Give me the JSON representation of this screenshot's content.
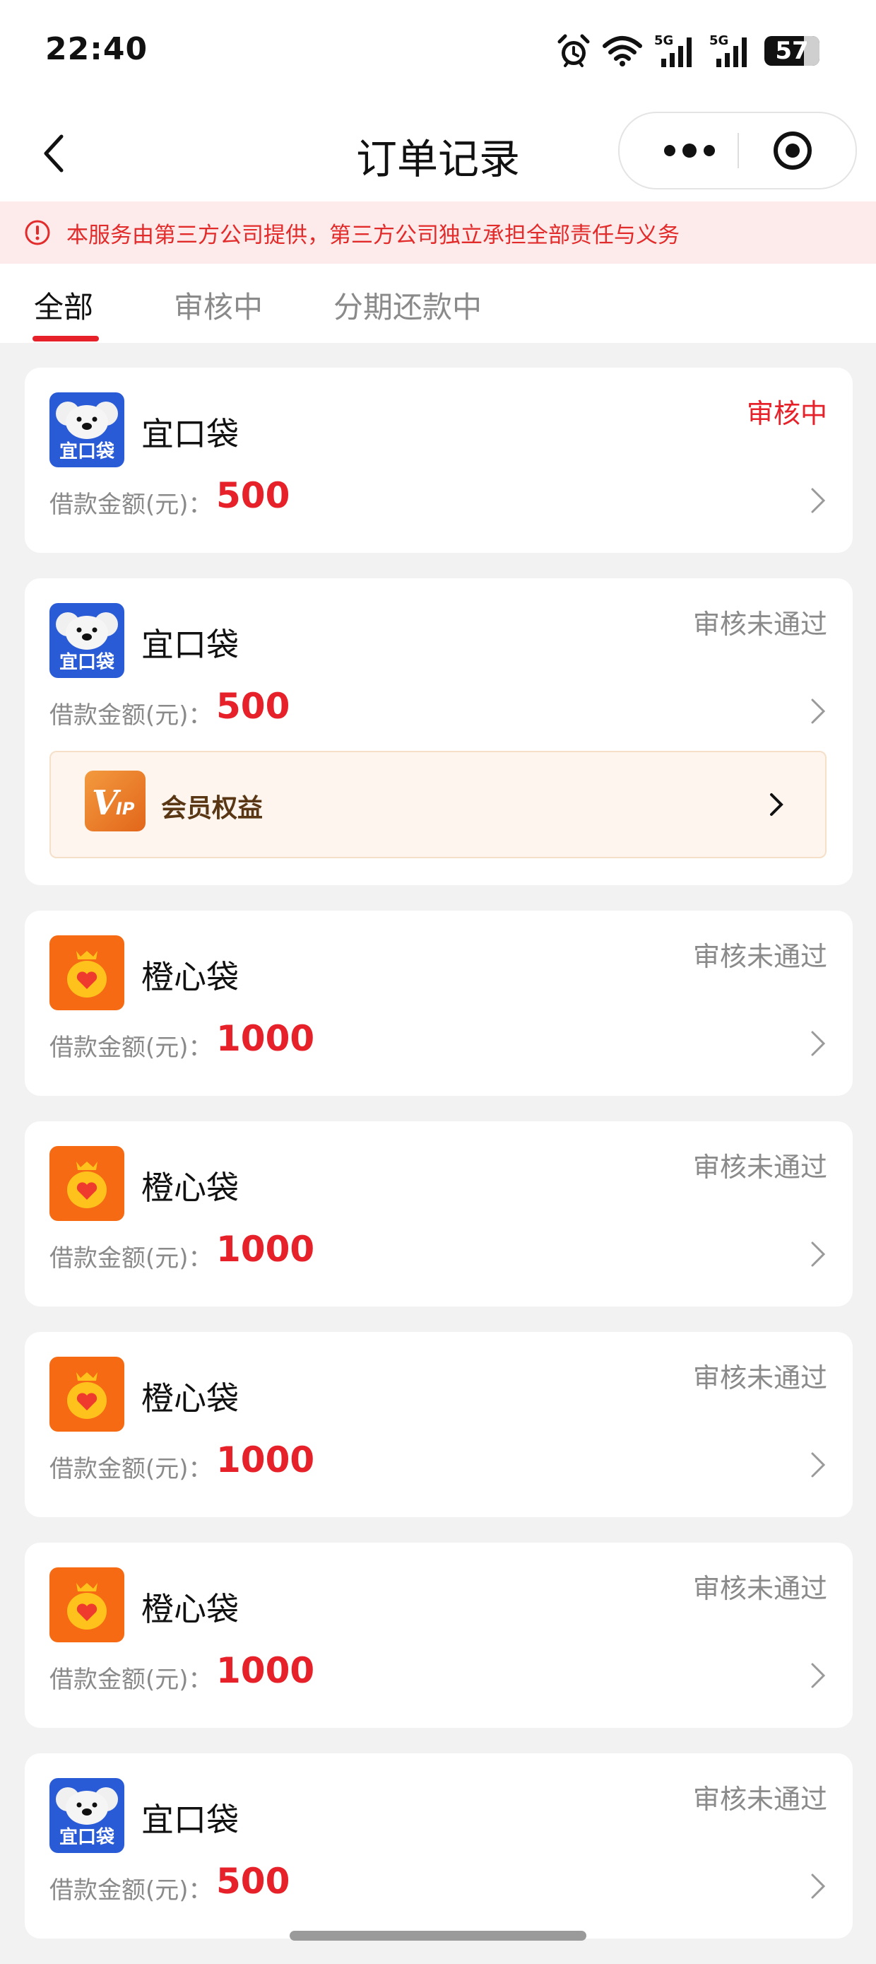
{
  "status_bar": {
    "time": "22:40",
    "network": "5G",
    "battery": "57"
  },
  "nav": {
    "title": "订单记录"
  },
  "notice": {
    "text": "本服务由第三方公司提供，第三方公司独立承担全部责任与义务"
  },
  "tabs": [
    {
      "label": "全部",
      "active": true
    },
    {
      "label": "审核中",
      "active": false
    },
    {
      "label": "分期还款中",
      "active": false
    }
  ],
  "amount_label": "借款金额(元)：",
  "orders": [
    {
      "logo": "koala-logo",
      "logo_text": "宜口袋",
      "name": "宜口袋",
      "status": "审核中",
      "status_color": "#e62129",
      "amount": "500"
    },
    {
      "logo": "koala-logo",
      "logo_text": "宜口袋",
      "name": "宜口袋",
      "status": "审核未通过",
      "status_color": "#8a8a8a",
      "amount": "500",
      "vip": {
        "label": "会员权益"
      }
    },
    {
      "logo": "money-bag-logo",
      "name": "橙心袋",
      "status": "审核未通过",
      "status_color": "#8a8a8a",
      "amount": "1000"
    },
    {
      "logo": "money-bag-logo",
      "name": "橙心袋",
      "status": "审核未通过",
      "status_color": "#8a8a8a",
      "amount": "1000"
    },
    {
      "logo": "money-bag-logo",
      "name": "橙心袋",
      "status": "审核未通过",
      "status_color": "#8a8a8a",
      "amount": "1000"
    },
    {
      "logo": "money-bag-logo",
      "name": "橙心袋",
      "status": "审核未通过",
      "status_color": "#8a8a8a",
      "amount": "1000"
    },
    {
      "logo": "koala-logo",
      "logo_text": "宜口袋",
      "name": "宜口袋",
      "status": "审核未通过",
      "status_color": "#8a8a8a",
      "amount": "500"
    }
  ],
  "colors": {
    "accent": "#e62129",
    "muted": "#8a8a8a",
    "background": "#f2f2f2"
  }
}
